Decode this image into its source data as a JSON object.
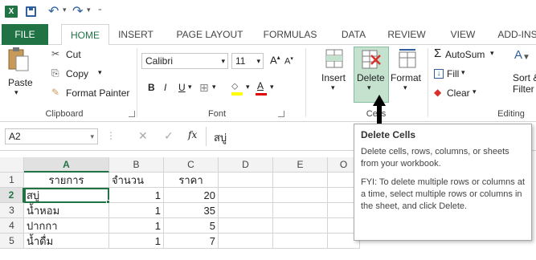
{
  "qat": {
    "app_icon": "X",
    "undo_icon": "undo-icon",
    "redo_icon": "redo-icon"
  },
  "tabs": [
    "FILE",
    "HOME",
    "INSERT",
    "PAGE LAYOUT",
    "FORMULAS",
    "DATA",
    "REVIEW",
    "VIEW",
    "ADD-INS"
  ],
  "active_tab": "HOME",
  "clipboard": {
    "paste": "Paste",
    "cut": "Cut",
    "copy": "Copy",
    "format_painter": "Format Painter",
    "group": "Clipboard"
  },
  "font": {
    "name": "Calibri",
    "size": "11",
    "bold": "B",
    "italic": "I",
    "underline": "U",
    "grow": "A",
    "shrink": "A",
    "color_letter": "A",
    "group": "Font"
  },
  "cells": {
    "insert": "Insert",
    "delete": "Delete",
    "format": "Format",
    "group": "Cells"
  },
  "editing": {
    "autosum": "AutoSum",
    "fill": "Fill",
    "clear": "Clear",
    "sort": "Sort &",
    "filter": "Filter",
    "group": "Editing"
  },
  "formula_bar": {
    "name_box": "A2",
    "fx": "fx",
    "content": "สบู่"
  },
  "grid": {
    "columns": [
      "A",
      "B",
      "C",
      "D",
      "E",
      "O"
    ],
    "rows": [
      {
        "num": "1",
        "a": "รายการ",
        "b": "จำนวน",
        "c": "ราคา"
      },
      {
        "num": "2",
        "a": "สบู่",
        "b": "1",
        "c": "20"
      },
      {
        "num": "3",
        "a": "น้ำหอม",
        "b": "1",
        "c": "35"
      },
      {
        "num": "4",
        "a": "ปากกา",
        "b": "1",
        "c": "5"
      },
      {
        "num": "5",
        "a": "น้ำดื่ม",
        "b": "1",
        "c": "7"
      }
    ]
  },
  "tooltip": {
    "title": "Delete Cells",
    "line1": "Delete cells, rows, columns, or sheets from your workbook.",
    "line2": "FYI: To delete multiple rows or columns at a time, select multiple rows or columns in the sheet, and click Delete."
  },
  "colors": {
    "accent": "#217346",
    "highlight": "#c5e2cf",
    "link": "#2f5f9e"
  }
}
